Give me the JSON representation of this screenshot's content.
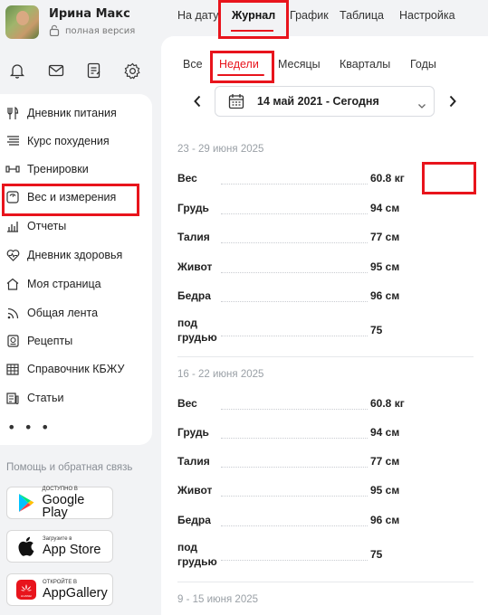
{
  "user": {
    "name": "Ирина Макс",
    "plan": "полная версия"
  },
  "quick_icons": [
    "bell-icon",
    "mail-icon",
    "notes-icon",
    "gear-icon"
  ],
  "sidebar": {
    "items": [
      {
        "label": "Дневник питания",
        "icon": "cutlery-icon"
      },
      {
        "label": "Курс похудения",
        "icon": "list-icon"
      },
      {
        "label": "Тренировки",
        "icon": "dumbbell-icon"
      },
      {
        "label": "Вес и измерения",
        "icon": "scale-icon"
      },
      {
        "label": "Отчеты",
        "icon": "bar-chart-icon"
      },
      {
        "label": "Дневник здоровья",
        "icon": "heart-pulse-icon"
      },
      {
        "label": "Моя страница",
        "icon": "home-icon"
      },
      {
        "label": "Общая лента",
        "icon": "feed-icon"
      },
      {
        "label": "Рецепты",
        "icon": "recipe-icon"
      },
      {
        "label": "Справочник КБЖУ",
        "icon": "table-icon"
      },
      {
        "label": "Статьи",
        "icon": "articles-icon"
      }
    ],
    "more": "• • •",
    "help": "Помощь и обратная связь"
  },
  "stores": [
    {
      "small": "ДОСТУПНО В",
      "big": "Google Play",
      "icon": "google-play-icon"
    },
    {
      "small": "Загрузите в",
      "big": "App Store",
      "icon": "apple-icon"
    },
    {
      "small": "ОТКРОЙТЕ В",
      "big": "AppGallery",
      "icon": "huawei-icon"
    }
  ],
  "top_tabs": [
    "На дату",
    "Журнал",
    "График",
    "Таблица",
    "Настройка"
  ],
  "active_top_tab": "Журнал",
  "period_tabs": [
    "Все",
    "Недели",
    "Месяцы",
    "Кварталы",
    "Годы"
  ],
  "active_period_tab": "Недели",
  "date_range": "14 май 2021 - Сегодня",
  "colors": {
    "accent": "#e8141c",
    "highlight_box": "#e8141c"
  },
  "weeks": [
    {
      "title": "23 - 29 июня 2025",
      "rows": [
        {
          "label": "Вес",
          "value": "60.8 кг"
        },
        {
          "label": "Грудь",
          "value": "94 см"
        },
        {
          "label": "Талия",
          "value": "77 см"
        },
        {
          "label": "Живот",
          "value": "95 см"
        },
        {
          "label": "Бедра",
          "value": "96 см"
        },
        {
          "label_line1": "под",
          "label_line2": "грудью",
          "value": "75"
        }
      ]
    },
    {
      "title": "16 - 22 июня 2025",
      "rows": [
        {
          "label": "Вес",
          "value": "60.8 кг"
        },
        {
          "label": "Грудь",
          "value": "94 см"
        },
        {
          "label": "Талия",
          "value": "77 см"
        },
        {
          "label": "Живот",
          "value": "95 см"
        },
        {
          "label": "Бедра",
          "value": "96 см"
        },
        {
          "label_line1": "под",
          "label_line2": "грудью",
          "value": "75"
        }
      ]
    },
    {
      "title": "9 - 15 июня 2025"
    }
  ]
}
